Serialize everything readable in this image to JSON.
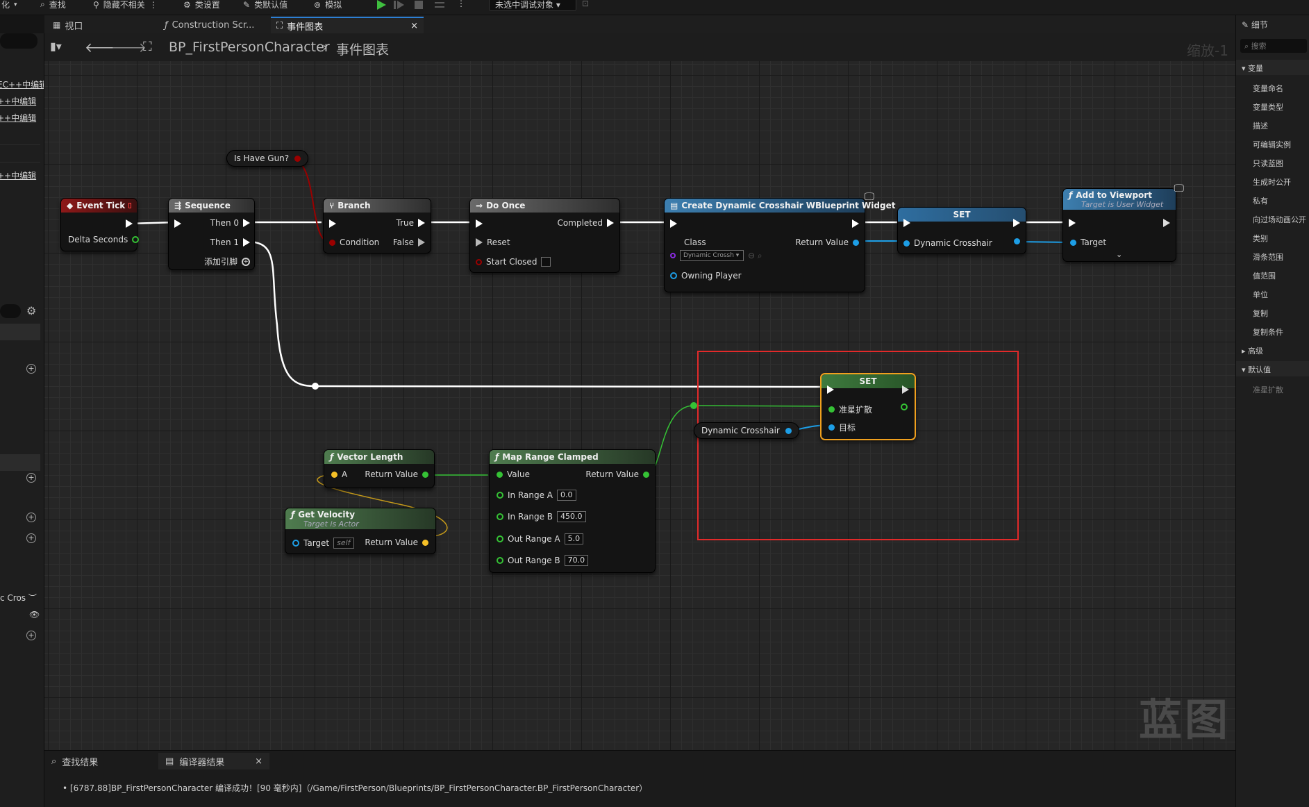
{
  "toolbar": {
    "items": [
      "化",
      "查找",
      "隐藏不相关",
      "类设置",
      "类默认值",
      "模拟"
    ],
    "debug_dropdown": "未选中调试对象"
  },
  "tabs": [
    {
      "label": "视口"
    },
    {
      "label": "Construction Scr..."
    },
    {
      "label": "事件图表"
    }
  ],
  "breadcrumb": {
    "blueprint": "BP_FirstPersonCharacter",
    "graph": "事件图表",
    "zoom": "缩放-1"
  },
  "left_panel": {
    "rows": [
      "EC++中编辑",
      "++中编辑",
      "++中编辑",
      "++中编辑",
      "c Cros"
    ]
  },
  "nodes": {
    "event_tick": {
      "title": "Event Tick",
      "pin_delta": "Delta Seconds"
    },
    "sequence": {
      "title": "Sequence",
      "then0": "Then 0",
      "then1": "Then 1",
      "add_pin": "添加引脚"
    },
    "is_have_gun": {
      "label": "Is Have Gun?"
    },
    "branch": {
      "title": "Branch",
      "true": "True",
      "false": "False",
      "condition": "Condition"
    },
    "do_once": {
      "title": "Do Once",
      "completed": "Completed",
      "reset": "Reset",
      "start_closed": "Start Closed"
    },
    "create_widget": {
      "title": "Create Dynamic Crosshair WBlueprint Widget",
      "class": "Class",
      "class_value": "Dynamic Crossh",
      "return_value": "Return Value",
      "owning_player": "Owning Player"
    },
    "set_top": {
      "title": "SET",
      "pin": "Dynamic Crosshair"
    },
    "add_to_viewport": {
      "title": "Add to Viewport",
      "subtitle": "Target is User Widget",
      "target": "Target"
    },
    "set_bottom": {
      "title": "SET",
      "pin_spread": "准星扩散",
      "pin_target": "目标"
    },
    "dyn_crosshair_var": {
      "label": "Dynamic Crosshair"
    },
    "vector_length": {
      "title": "Vector Length",
      "a": "A",
      "return_value": "Return Value"
    },
    "get_velocity": {
      "title": "Get Velocity",
      "subtitle": "Target is Actor",
      "target": "Target",
      "target_value": "self",
      "return_value": "Return Value"
    },
    "map_range": {
      "title": "Map Range Clamped",
      "value": "Value",
      "return_value": "Return Value",
      "in_a": "In Range A",
      "in_a_val": "0.0",
      "in_b": "In Range B",
      "in_b_val": "450.0",
      "out_a": "Out Range A",
      "out_a_val": "5.0",
      "out_b": "Out Range B",
      "out_b_val": "70.0"
    }
  },
  "watermark": "蓝图",
  "right_panel": {
    "title": "细节",
    "search_placeholder": "搜索",
    "section_vars": "变量",
    "items": [
      "变量命名",
      "变量类型",
      "描述",
      "可编辑实例",
      "只读蓝图",
      "生成时公开",
      "私有",
      "向过场动画公开",
      "类别",
      "滑条范围",
      "值范围",
      "单位",
      "复制",
      "复制条件"
    ],
    "section_advanced": "高级",
    "section_defaults": "默认值",
    "default_item": "准星扩散"
  },
  "bottom_panel": {
    "tab_find": "查找结果",
    "tab_compiler": "编译器结果",
    "log_line": "[6787.88]BP_FirstPersonCharacter 编译成功！[90 毫秒内]（/Game/FirstPerson/Blueprints/BP_FirstPersonCharacter.BP_FirstPersonCharacter）"
  },
  "colors": {
    "exec": "#ffffff",
    "bool": "#9b0000",
    "float": "#35c235",
    "object": "#1d9ee6",
    "vector": "#f5c027",
    "highlight": "#e22a2a",
    "selection": "#f0a01e"
  }
}
